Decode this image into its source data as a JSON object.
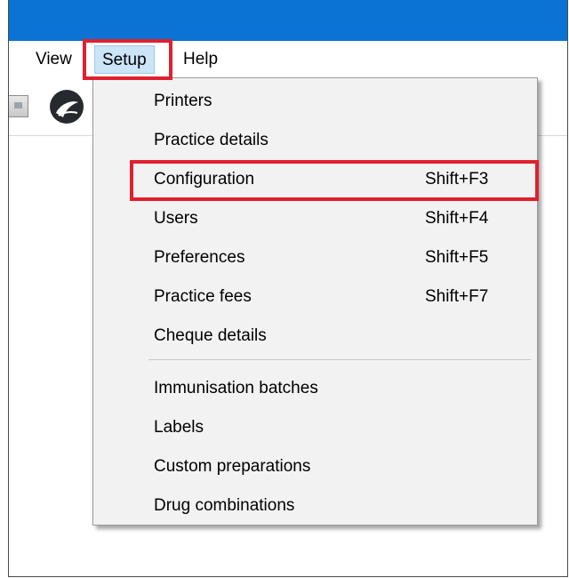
{
  "menubar": {
    "items": [
      {
        "label": "View"
      },
      {
        "label": "Setup"
      },
      {
        "label": "Help"
      }
    ]
  },
  "toolbar": {
    "icons": [
      "card-icon",
      "globe-icon"
    ]
  },
  "setup_menu": {
    "items": [
      {
        "label": "Printers",
        "shortcut": ""
      },
      {
        "label": "Practice details",
        "shortcut": ""
      },
      {
        "label": "Configuration",
        "shortcut": "Shift+F3"
      },
      {
        "label": "Users",
        "shortcut": "Shift+F4"
      },
      {
        "label": "Preferences",
        "shortcut": "Shift+F5"
      },
      {
        "label": "Practice fees",
        "shortcut": "Shift+F7"
      },
      {
        "label": "Cheque details",
        "shortcut": ""
      },
      {
        "label": "Immunisation batches",
        "shortcut": ""
      },
      {
        "label": "Labels",
        "shortcut": ""
      },
      {
        "label": "Custom preparations",
        "shortcut": ""
      },
      {
        "label": "Drug combinations",
        "shortcut": ""
      }
    ]
  },
  "colors": {
    "titlebar": "#0a73d4",
    "highlight": "#e0202e",
    "menu_selected": "#cce4f7",
    "menu_background": "#f2f2f2"
  }
}
